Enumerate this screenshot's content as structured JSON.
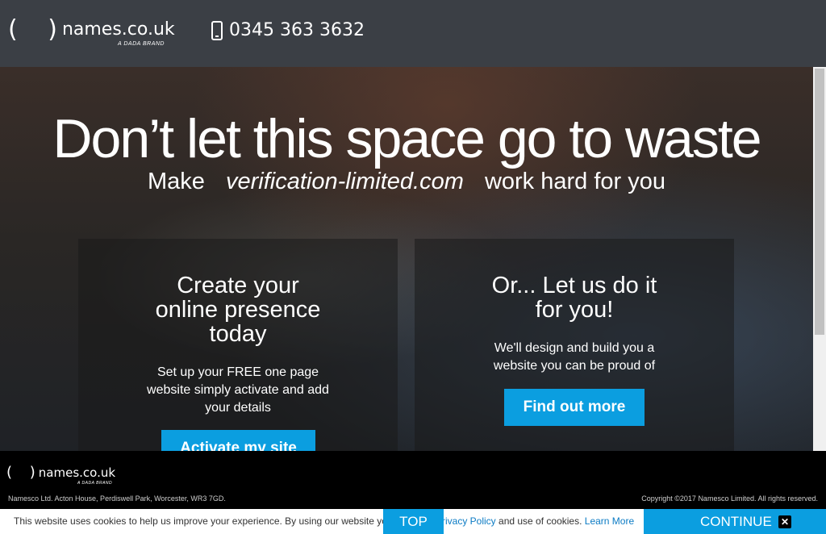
{
  "header": {
    "logo_mark": "( )",
    "logo_text": "names.co.uk",
    "logo_sub": "A DADA BRAND",
    "phone_number": "0345 363 3632"
  },
  "hero": {
    "headline": "Don’t let this space go to waste",
    "sub_prefix": "Make",
    "domain": "verification-limited.com",
    "sub_suffix": "work hard for you"
  },
  "panels": {
    "left": {
      "title": "Create your online presence today",
      "text": "Set up your FREE one page website simply activate and add your details",
      "button": "Activate my site"
    },
    "right": {
      "title": "Or... Let us do it for you!",
      "text": "We'll design and build you a website you can be proud of",
      "button": "Find out more"
    }
  },
  "footer": {
    "logo_mark": "( )",
    "logo_text": "names.co.uk",
    "logo_sub": "A DADA BRAND",
    "address": "Namesco Ltd. Acton House, Perdiswell Park, Worcester, WR3 7GD.",
    "copyright": "Copyright ©2017 Namesco Limited. All rights reserved."
  },
  "cookie_bar": {
    "text_start": "This website uses cookies to help us improve your experience. By using our website yo",
    "text_end_link": "rivacy Policy",
    "text_end": " and use of cookies. ",
    "learn_more": "Learn More",
    "top_label": "TOP",
    "continue_label": "CONTINUE",
    "close_symbol": "✕"
  },
  "colors": {
    "header_bg": "#3b3f45",
    "accent": "#0b9ee0",
    "footer_bg": "#000000"
  }
}
